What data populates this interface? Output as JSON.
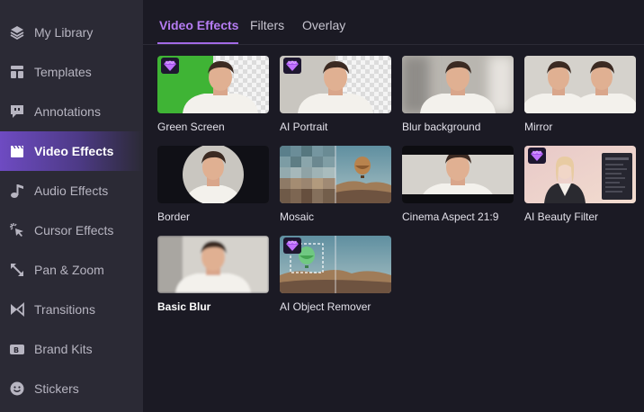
{
  "sidebar": {
    "items": [
      {
        "label": "My Library",
        "icon": "layers-icon"
      },
      {
        "label": "Templates",
        "icon": "templates-icon"
      },
      {
        "label": "Annotations",
        "icon": "annotation-icon"
      },
      {
        "label": "Video Effects",
        "icon": "clapperboard-icon",
        "active": true
      },
      {
        "label": "Audio Effects",
        "icon": "music-note-icon"
      },
      {
        "label": "Cursor Effects",
        "icon": "cursor-click-icon"
      },
      {
        "label": "Pan & Zoom",
        "icon": "expand-arrow-icon"
      },
      {
        "label": "Transitions",
        "icon": "transition-icon"
      },
      {
        "label": "Brand Kits",
        "icon": "brand-kit-icon"
      },
      {
        "label": "Stickers",
        "icon": "smiley-icon"
      }
    ]
  },
  "tabs": [
    {
      "label": "Video Effects",
      "active": true
    },
    {
      "label": "Filters"
    },
    {
      "label": "Overlay"
    }
  ],
  "effects": [
    {
      "label": "Green Screen",
      "premium": true
    },
    {
      "label": "AI Portrait",
      "premium": true
    },
    {
      "label": "Blur background"
    },
    {
      "label": "Mirror"
    },
    {
      "label": "Border"
    },
    {
      "label": "Mosaic"
    },
    {
      "label": "Cinema Aspect 21:9"
    },
    {
      "label": "AI Beauty Filter",
      "premium": true
    },
    {
      "label": "Basic Blur"
    },
    {
      "label": "AI Object Remover",
      "premium": true
    }
  ],
  "colors": {
    "accent": "#b57cf2",
    "sidebar_bg": "#2b2a35",
    "main_bg": "#1b1a24",
    "gem": "#c070ff"
  }
}
